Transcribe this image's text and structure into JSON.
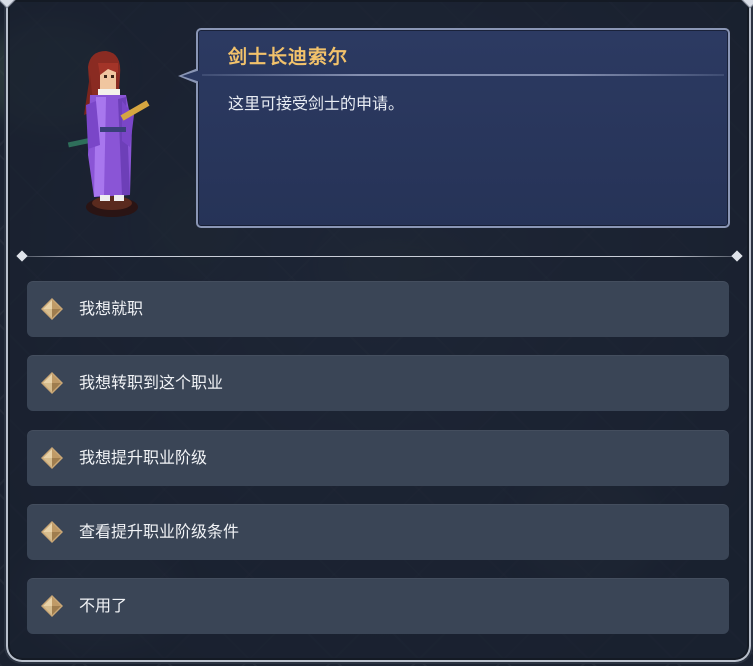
{
  "npc": {
    "name": "剑士长迪索尔",
    "dialog": "这里可接受剑士的申请。"
  },
  "options": [
    {
      "label": "我想就职"
    },
    {
      "label": "我想转职到这个职业"
    },
    {
      "label": "我想提升职业阶级"
    },
    {
      "label": "查看提升职业阶级条件"
    },
    {
      "label": "不用了"
    }
  ],
  "colors": {
    "name_gold": "#f2c26b",
    "bubble_bg": "#2a375d",
    "option_bg": "#3a4556",
    "robe_purple": "#8a55d6"
  },
  "icons": {
    "option_marker": "diamond-icon"
  }
}
